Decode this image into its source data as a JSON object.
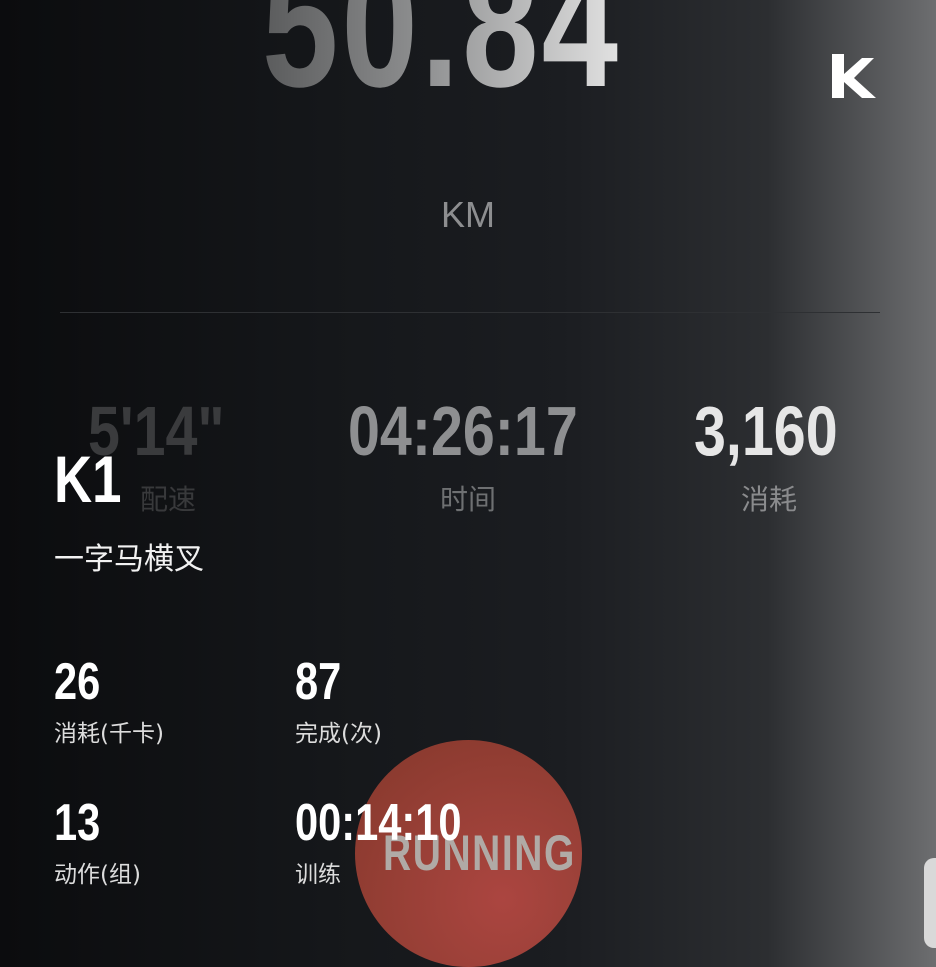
{
  "summary": {
    "distance": "50.84",
    "unit": "KM",
    "pace": {
      "value": "5'14\"",
      "label": "配速"
    },
    "time": {
      "value": "04:26:17",
      "label": "时间"
    },
    "calories": {
      "value": "3,160",
      "label": "消耗"
    }
  },
  "exercise": {
    "code": "K1",
    "name": "一字马横叉",
    "metrics": [
      {
        "value": "26",
        "label": "消耗(千卡)"
      },
      {
        "value": "87",
        "label": "完成(次)"
      },
      {
        "value": "13",
        "label": "动作(组)"
      },
      {
        "value": "00:14:10",
        "label": "训练"
      }
    ]
  },
  "running_button": {
    "label": "RUNNING",
    "color": "#a8463c"
  },
  "logo": {
    "icon": "keep-k-logo-icon"
  }
}
